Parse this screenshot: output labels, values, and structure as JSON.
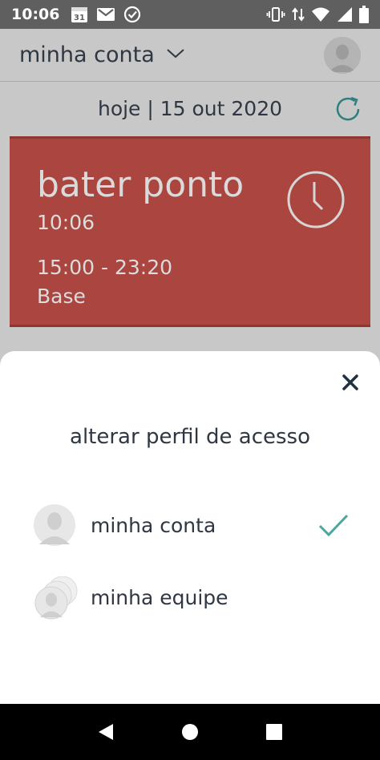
{
  "status_bar": {
    "time": "10:06",
    "calendar_day": "31",
    "icons": [
      "calendar-icon",
      "gmail-icon",
      "check-circle-icon",
      "vibrate-icon",
      "data-arrows-icon",
      "wifi-icon",
      "signal-icon",
      "battery-icon"
    ]
  },
  "header": {
    "account_title": "minha conta"
  },
  "date_row": {
    "date_text": "hoje | 15 out 2020"
  },
  "clock_card": {
    "title": "bater ponto",
    "current_time": "10:06",
    "shift": "15:00 - 23:20",
    "place": "Base",
    "color": "#aa463f"
  },
  "sheet": {
    "title": "alterar perfil de acesso",
    "options": [
      {
        "label": "minha conta",
        "selected": true
      },
      {
        "label": "minha equipe",
        "selected": false
      }
    ],
    "accent_color": "#4aa6a0"
  }
}
